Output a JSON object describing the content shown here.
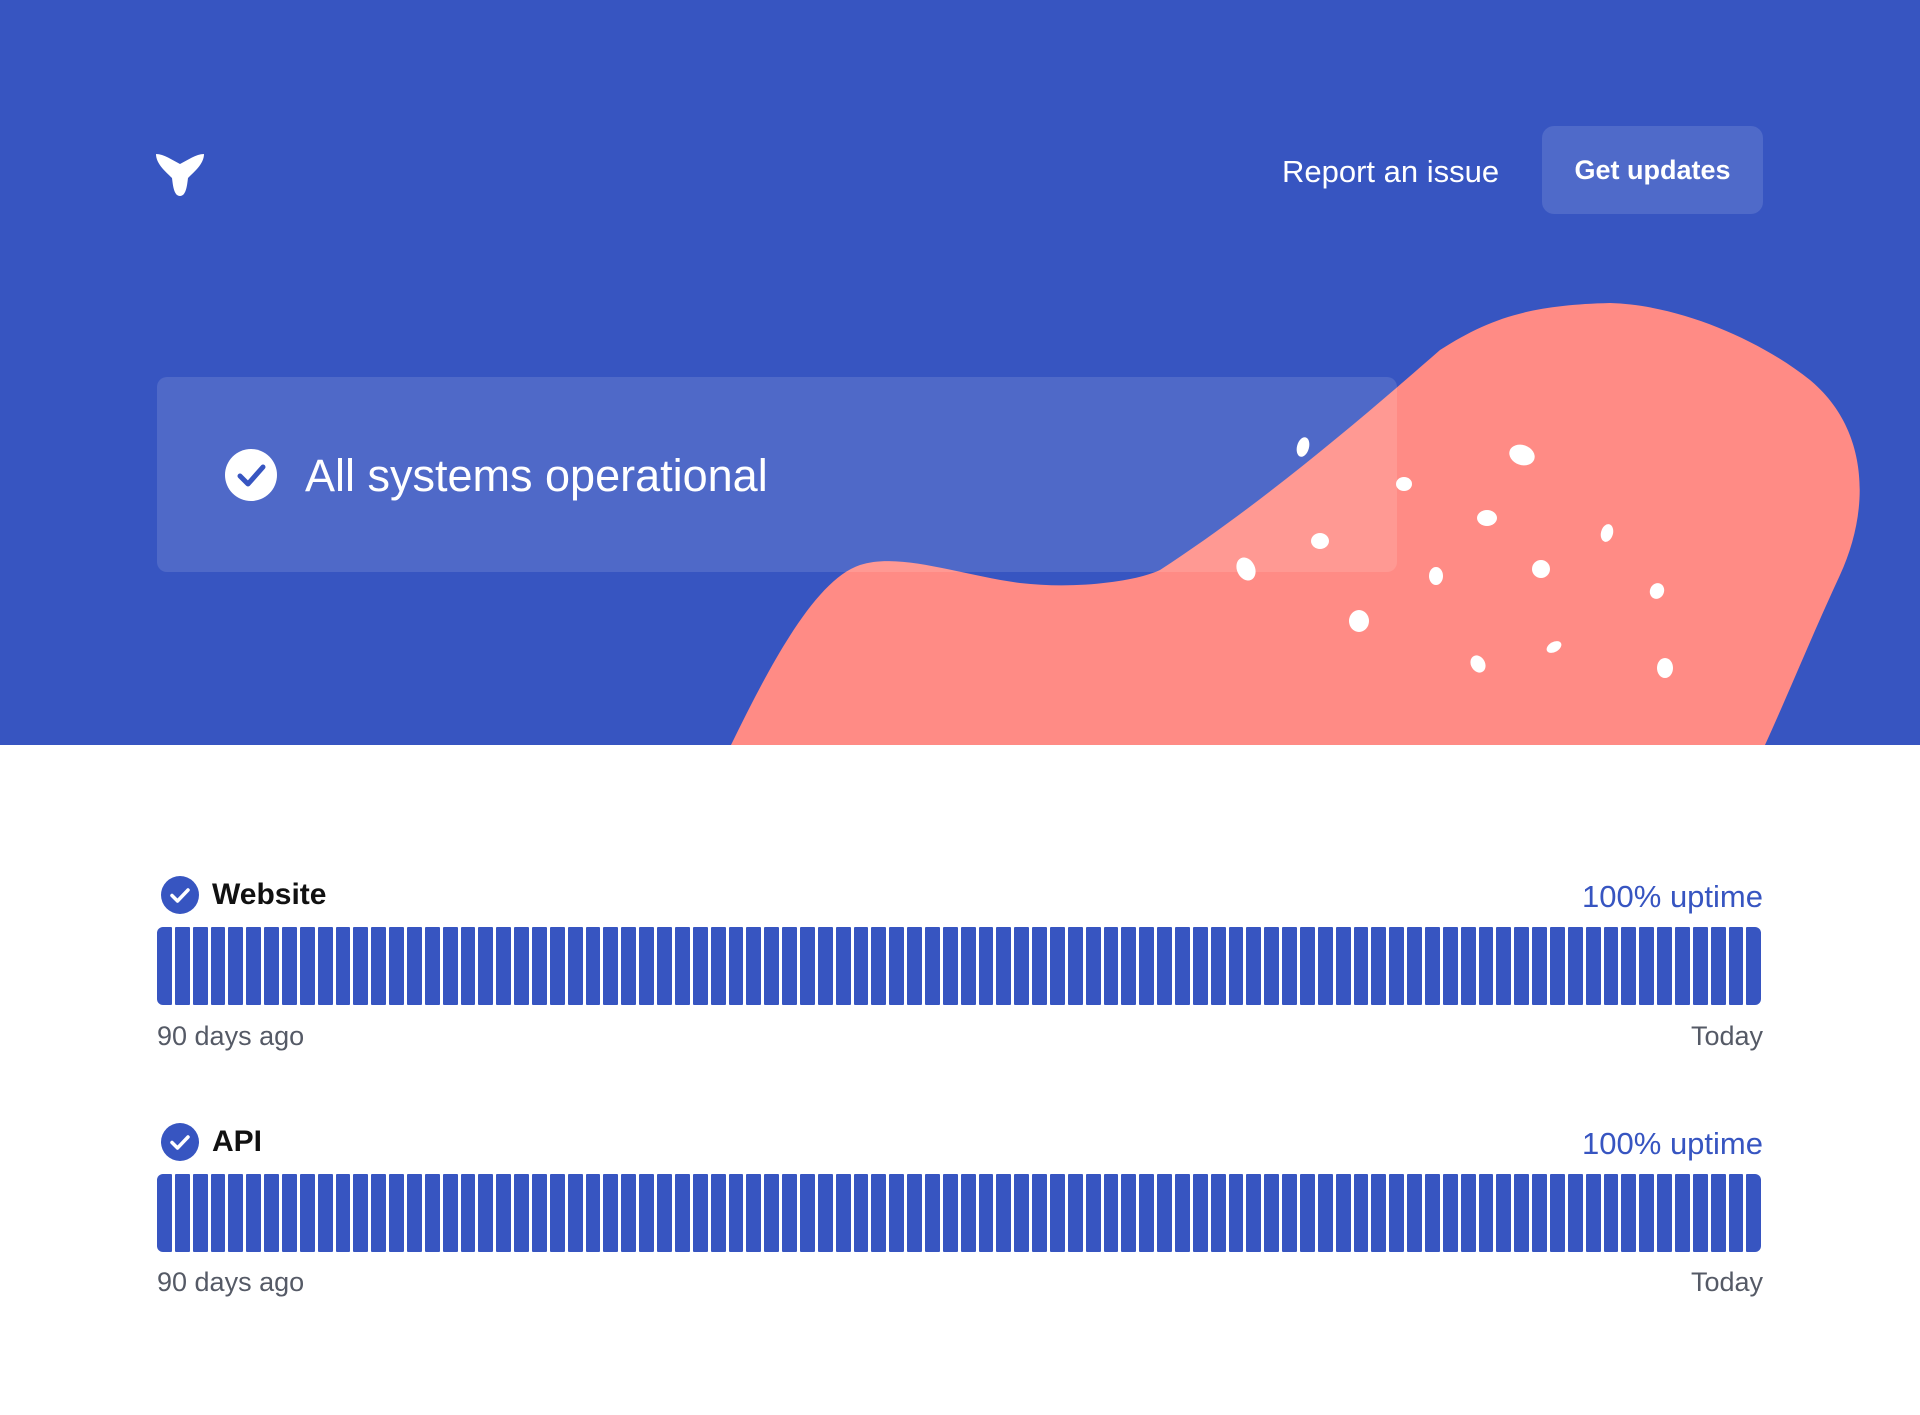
{
  "header": {
    "logo_icon": "brand-logo-icon",
    "report_label": "Report an issue",
    "updates_label": "Get updates"
  },
  "status": {
    "icon": "check-circle-icon",
    "text": "All systems operational"
  },
  "colors": {
    "brand": "#3755c1",
    "blob": "#ff8b85",
    "button_bg": "#4f6ac9",
    "text_muted": "#555a66"
  },
  "monitors": [
    {
      "name": "Website",
      "icon": "check-circle-icon",
      "uptime_label": "100% uptime",
      "uptime_percent": 100,
      "bar_count": 90,
      "days_up": 90,
      "start_label": "90 days ago",
      "end_label": "Today"
    },
    {
      "name": "API",
      "icon": "check-circle-icon",
      "uptime_label": "100% uptime",
      "uptime_percent": 100,
      "bar_count": 90,
      "days_up": 90,
      "start_label": "90 days ago",
      "end_label": "Today"
    }
  ]
}
